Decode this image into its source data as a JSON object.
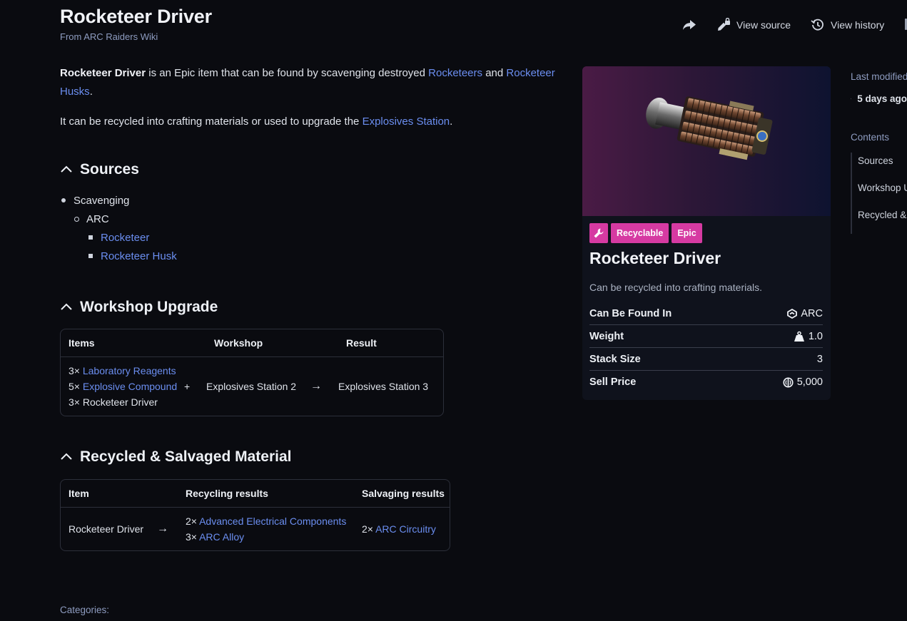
{
  "header": {
    "title": "Rocketeer Driver",
    "subtitle": "From ARC Raiders Wiki",
    "actions": {
      "view_source": "View source",
      "view_history": "View history"
    }
  },
  "intro": {
    "p1": {
      "bold": "Rocketeer Driver",
      "t1": " is an Epic item that can be found by scavenging destroyed ",
      "link1": "Rocketeers",
      "t2": " and ",
      "link2": "Rocketeer Husks",
      "t3": "."
    },
    "p2": {
      "t1": "It can be recycled into crafting materials or used to upgrade the ",
      "link1": "Explosives Station",
      "t2": "."
    }
  },
  "sources": {
    "heading": "Sources",
    "l1": "Scavenging",
    "l2": "ARC",
    "l3a": "Rocketeer",
    "l3b": "Rocketeer Husk"
  },
  "workshop": {
    "heading": "Workshop Upgrade",
    "headers": [
      "Items",
      "Workshop",
      "Result"
    ],
    "items": [
      {
        "qty": "3×",
        "name": "Laboratory Reagents"
      },
      {
        "qty": "5×",
        "name": "Explosive Compound"
      },
      {
        "qty": "3×",
        "name": "Rocketeer Driver"
      }
    ],
    "plus": "+",
    "arrow": "→",
    "workshop": "Explosives Station 2",
    "result": "Explosives Station 3"
  },
  "recycled": {
    "heading": "Recycled & Salvaged Material",
    "headers": [
      "Item",
      "Recycling results",
      "Salvaging results"
    ],
    "item": "Rocketeer Driver",
    "arrow": "→",
    "recycling": [
      {
        "qty": "2×",
        "name": "Advanced Electrical Components"
      },
      {
        "qty": "3×",
        "name": "ARC Alloy"
      }
    ],
    "salvaging": [
      {
        "qty": "2×",
        "name": "ARC Circuitry"
      }
    ]
  },
  "infobox": {
    "badges": [
      "Recyclable",
      "Epic"
    ],
    "badge_color": "#d63aa2",
    "title": "Rocketeer Driver",
    "description": "Can be recycled into crafting materials.",
    "rows": [
      {
        "key": "Can Be Found In",
        "value": "ARC",
        "icon": "arc-icon"
      },
      {
        "key": "Weight",
        "value": "1.0",
        "icon": "weight-icon"
      },
      {
        "key": "Stack Size",
        "value": "3",
        "icon": ""
      },
      {
        "key": "Sell Price",
        "value": "5,000",
        "icon": "coin-icon"
      }
    ]
  },
  "sidebar": {
    "last_modified": "Last modified",
    "ago": "5 days ago",
    "contents_label": "Contents",
    "toc": [
      "Sources",
      "Workshop Upgrade",
      "Recycled & Salvaged Material"
    ]
  },
  "footer": {
    "categories": "Categories:"
  },
  "colors": {
    "background": "#0a0b10",
    "link": "#6b8ef0",
    "accent": "#d63aa2"
  }
}
